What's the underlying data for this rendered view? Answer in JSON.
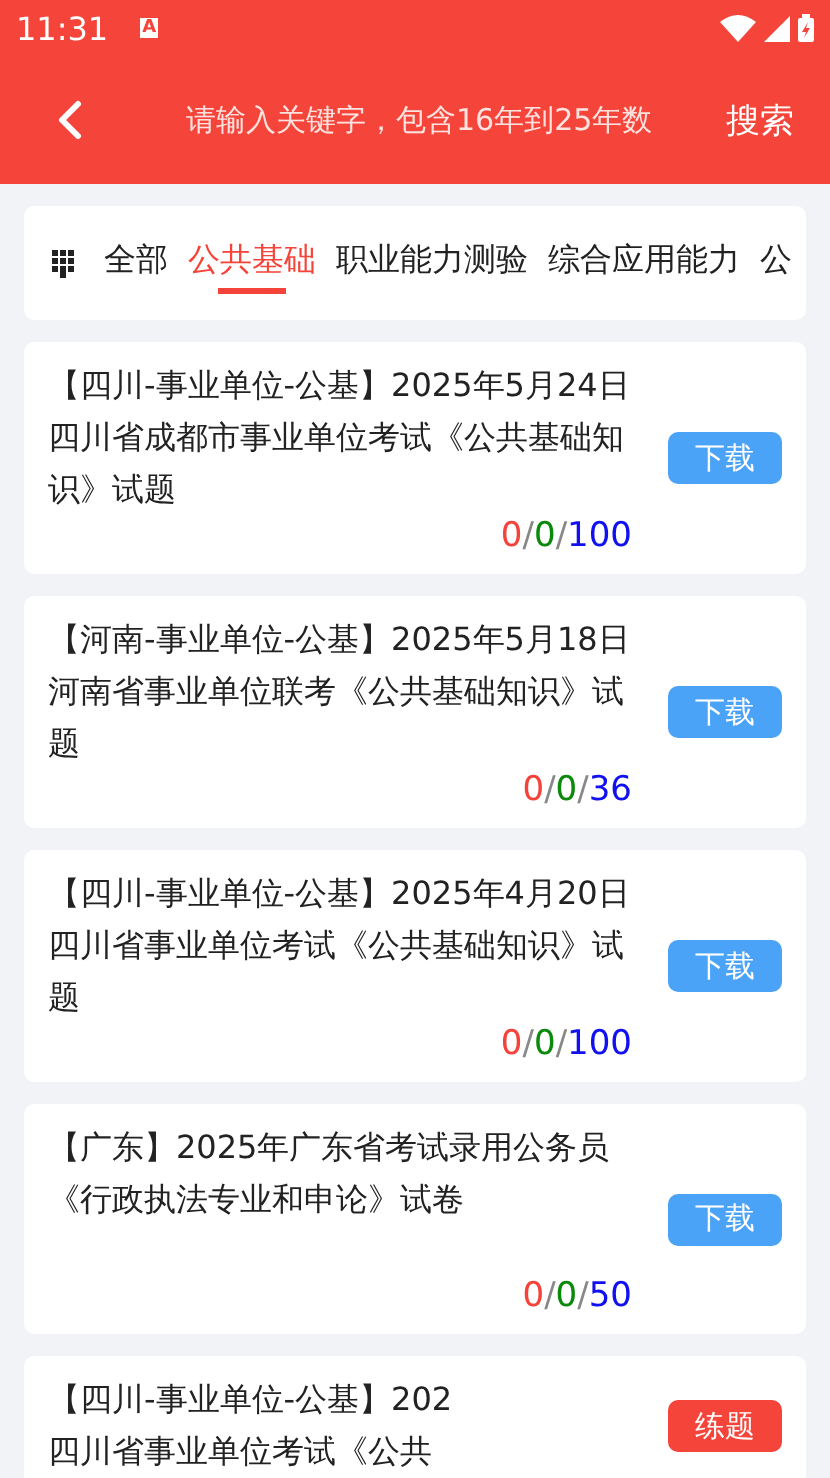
{
  "status_bar": {
    "time": "11:31",
    "notification": "A"
  },
  "header": {
    "search": {
      "placeholder": "请输入关键字，包含16年到25年数"
    },
    "search_button": "搜索"
  },
  "tabs": [
    {
      "label": "全部",
      "selected": false
    },
    {
      "label": "公共基础",
      "selected": true
    },
    {
      "label": "职业能力测验",
      "selected": false
    },
    {
      "label": "综合应用能力",
      "selected": false
    },
    {
      "label": "公",
      "selected": false
    }
  ],
  "papers": [
    {
      "title": "【四川-事业单位-公基】2025年5月24日四川省成都市事业单位考试《公共基础知识》试题",
      "button": {
        "kind": "download",
        "label": "下载"
      },
      "score": [
        {
          "text": "0",
          "color": "#f5423a"
        },
        {
          "text": "/",
          "color": "#888888"
        },
        {
          "text": "0",
          "color": "#0a8a0a"
        },
        {
          "text": "/",
          "color": "#888888"
        },
        {
          "text": "100",
          "color": "#1010f0"
        }
      ]
    },
    {
      "title": "【河南-事业单位-公基】2025年5月18日河南省事业单位联考《公共基础知识》试题",
      "button": {
        "kind": "download",
        "label": "下载"
      },
      "score": [
        {
          "text": "0",
          "color": "#f5423a"
        },
        {
          "text": "/",
          "color": "#888888"
        },
        {
          "text": "0",
          "color": "#0a8a0a"
        },
        {
          "text": "/",
          "color": "#888888"
        },
        {
          "text": "36",
          "color": "#1010f0"
        }
      ]
    },
    {
      "title": "【四川-事业单位-公基】2025年4月20日四川省事业单位考试《公共基础知识》试题",
      "button": {
        "kind": "download",
        "label": "下载"
      },
      "score": [
        {
          "text": "0",
          "color": "#f5423a"
        },
        {
          "text": "/",
          "color": "#888888"
        },
        {
          "text": "0",
          "color": "#0a8a0a"
        },
        {
          "text": "/",
          "color": "#888888"
        },
        {
          "text": "100",
          "color": "#1010f0"
        }
      ]
    },
    {
      "title": "【广东】2025年广东省考试录用公务员《行政执法专业和申论》试卷",
      "button": {
        "kind": "download",
        "label": "下载"
      },
      "score": [
        {
          "text": "0",
          "color": "#f5423a"
        },
        {
          "text": "/",
          "color": "#888888"
        },
        {
          "text": "0",
          "color": "#0a8a0a"
        },
        {
          "text": "/",
          "color": "#888888"
        },
        {
          "text": "50",
          "color": "#1010f0"
        }
      ]
    },
    {
      "title": "【四川-事业单位-公基】202",
      "title_line_2": "四川省事业单位考试《公共",
      "button": {
        "kind": "practice",
        "label": "练题"
      }
    }
  ]
}
